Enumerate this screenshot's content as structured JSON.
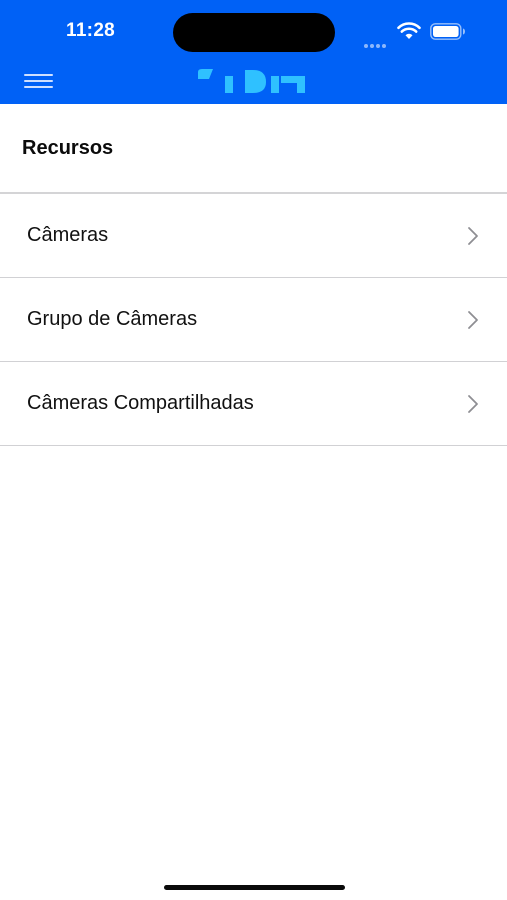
{
  "status_bar": {
    "time": "11:28"
  },
  "header": {
    "background_color": "#0061f6",
    "menu_icon": "hamburger-menu-icon",
    "logo_icon": "brand-logo"
  },
  "main": {
    "section_title": "Recursos",
    "items": [
      {
        "label": "Câmeras",
        "icon": "chevron-right-icon"
      },
      {
        "label": "Grupo de Câmeras",
        "icon": "chevron-right-icon"
      },
      {
        "label": "Câmeras Compartilhadas",
        "icon": "chevron-right-icon"
      }
    ]
  }
}
